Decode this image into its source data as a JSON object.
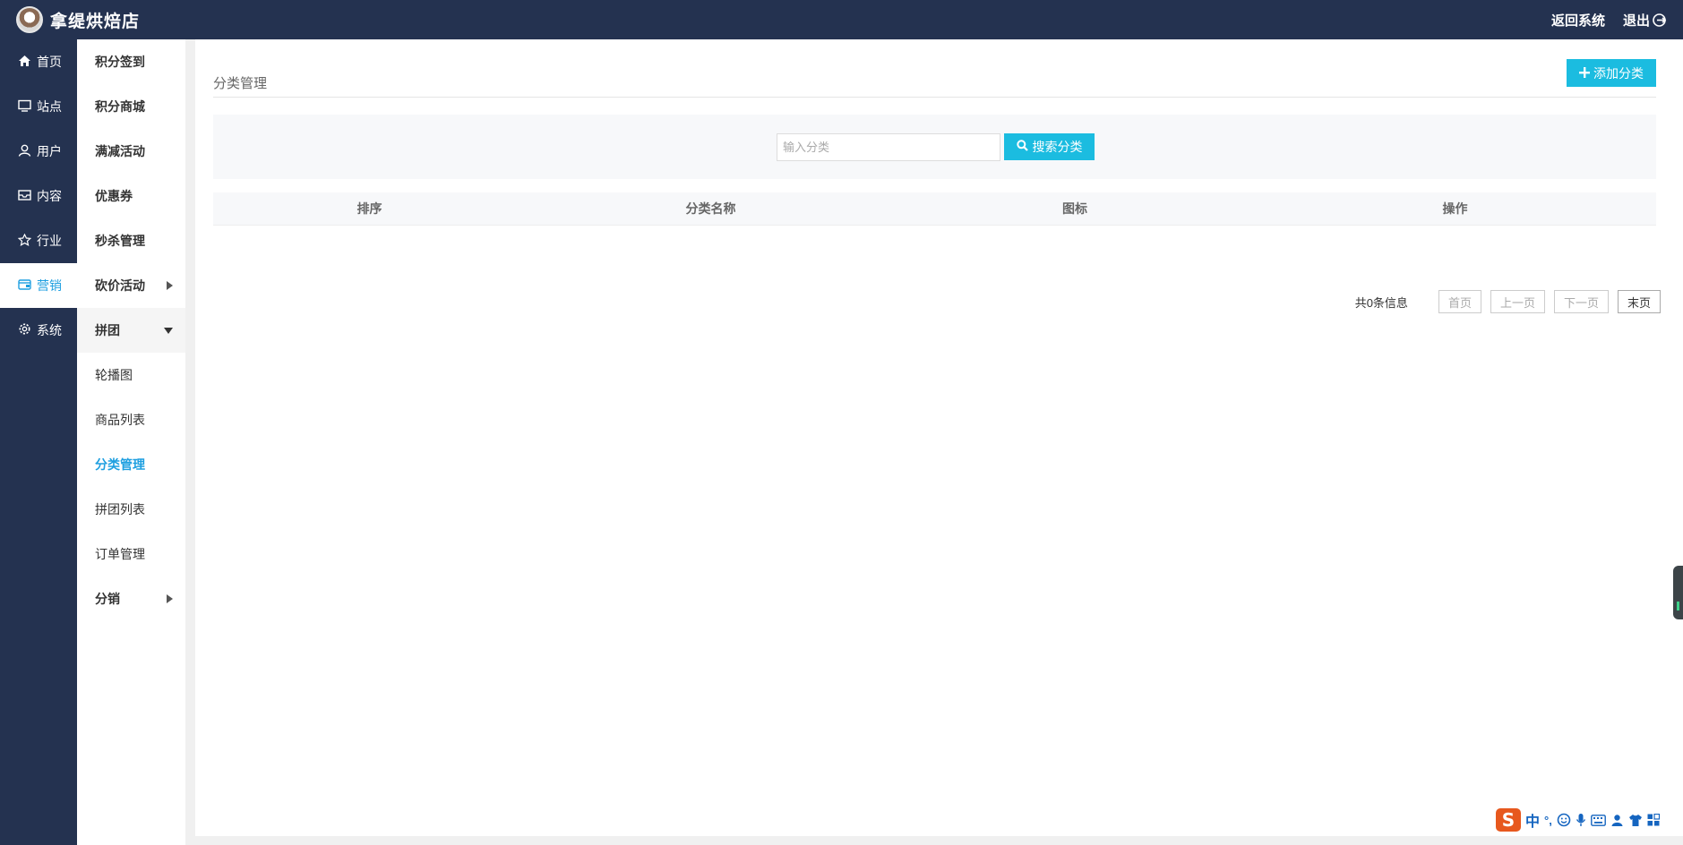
{
  "header": {
    "store_name": "拿缇烘焙店",
    "back_label": "返回系统",
    "logout_label": "退出"
  },
  "primary_nav": [
    {
      "label": "首页",
      "icon": "home-icon"
    },
    {
      "label": "站点",
      "icon": "monitor-icon"
    },
    {
      "label": "用户",
      "icon": "user-icon"
    },
    {
      "label": "内容",
      "icon": "inbox-icon"
    },
    {
      "label": "行业",
      "icon": "star-icon"
    },
    {
      "label": "营销",
      "icon": "wallet-icon",
      "active": true
    },
    {
      "label": "系统",
      "icon": "gear-icon"
    }
  ],
  "secondary_nav": [
    {
      "label": "积分签到"
    },
    {
      "label": "积分商城"
    },
    {
      "label": "满减活动"
    },
    {
      "label": "优惠券"
    },
    {
      "label": "秒杀管理"
    },
    {
      "label": "砍价活动",
      "caret": "right"
    },
    {
      "label": "拼团",
      "caret": "down"
    },
    {
      "label": "轮播图"
    },
    {
      "label": "商品列表"
    },
    {
      "label": "分类管理",
      "active": true
    },
    {
      "label": "拼团列表"
    },
    {
      "label": "订单管理"
    },
    {
      "label": "分销",
      "caret": "right"
    }
  ],
  "page": {
    "title": "分类管理",
    "add_button": "添加分类"
  },
  "search": {
    "placeholder": "输入分类",
    "value": "",
    "button": "搜索分类"
  },
  "table": {
    "columns": [
      "排序",
      "分类名称",
      "图标",
      "操作"
    ],
    "rows": []
  },
  "pagination": {
    "info": "共0条信息",
    "first": "首页",
    "prev": "上一页",
    "next": "下一页",
    "last": "末页"
  },
  "ime": {
    "mode": "中",
    "punct": "°,"
  },
  "colors": {
    "nav_bg": "#243250",
    "accent": "#1bbce0",
    "active_text": "#1e9fe0"
  }
}
